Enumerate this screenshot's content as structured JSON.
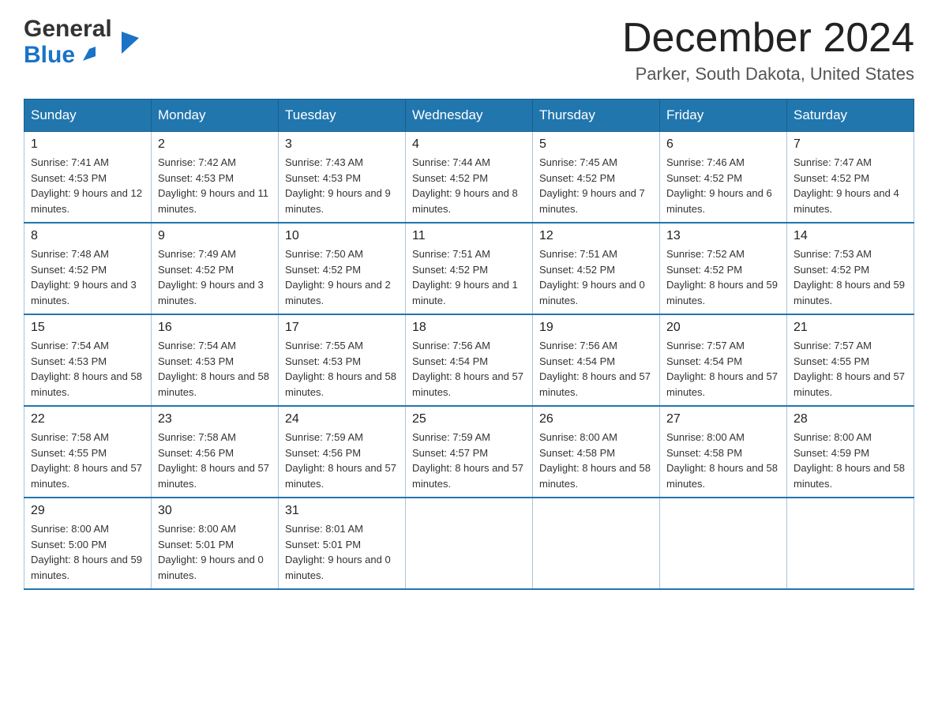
{
  "header": {
    "title": "December 2024",
    "location": "Parker, South Dakota, United States",
    "logo_general": "General",
    "logo_blue": "Blue"
  },
  "days_of_week": [
    "Sunday",
    "Monday",
    "Tuesday",
    "Wednesday",
    "Thursday",
    "Friday",
    "Saturday"
  ],
  "weeks": [
    [
      {
        "day": "1",
        "sunrise": "7:41 AM",
        "sunset": "4:53 PM",
        "daylight": "9 hours and 12 minutes."
      },
      {
        "day": "2",
        "sunrise": "7:42 AM",
        "sunset": "4:53 PM",
        "daylight": "9 hours and 11 minutes."
      },
      {
        "day": "3",
        "sunrise": "7:43 AM",
        "sunset": "4:53 PM",
        "daylight": "9 hours and 9 minutes."
      },
      {
        "day": "4",
        "sunrise": "7:44 AM",
        "sunset": "4:52 PM",
        "daylight": "9 hours and 8 minutes."
      },
      {
        "day": "5",
        "sunrise": "7:45 AM",
        "sunset": "4:52 PM",
        "daylight": "9 hours and 7 minutes."
      },
      {
        "day": "6",
        "sunrise": "7:46 AM",
        "sunset": "4:52 PM",
        "daylight": "9 hours and 6 minutes."
      },
      {
        "day": "7",
        "sunrise": "7:47 AM",
        "sunset": "4:52 PM",
        "daylight": "9 hours and 4 minutes."
      }
    ],
    [
      {
        "day": "8",
        "sunrise": "7:48 AM",
        "sunset": "4:52 PM",
        "daylight": "9 hours and 3 minutes."
      },
      {
        "day": "9",
        "sunrise": "7:49 AM",
        "sunset": "4:52 PM",
        "daylight": "9 hours and 3 minutes."
      },
      {
        "day": "10",
        "sunrise": "7:50 AM",
        "sunset": "4:52 PM",
        "daylight": "9 hours and 2 minutes."
      },
      {
        "day": "11",
        "sunrise": "7:51 AM",
        "sunset": "4:52 PM",
        "daylight": "9 hours and 1 minute."
      },
      {
        "day": "12",
        "sunrise": "7:51 AM",
        "sunset": "4:52 PM",
        "daylight": "9 hours and 0 minutes."
      },
      {
        "day": "13",
        "sunrise": "7:52 AM",
        "sunset": "4:52 PM",
        "daylight": "8 hours and 59 minutes."
      },
      {
        "day": "14",
        "sunrise": "7:53 AM",
        "sunset": "4:52 PM",
        "daylight": "8 hours and 59 minutes."
      }
    ],
    [
      {
        "day": "15",
        "sunrise": "7:54 AM",
        "sunset": "4:53 PM",
        "daylight": "8 hours and 58 minutes."
      },
      {
        "day": "16",
        "sunrise": "7:54 AM",
        "sunset": "4:53 PM",
        "daylight": "8 hours and 58 minutes."
      },
      {
        "day": "17",
        "sunrise": "7:55 AM",
        "sunset": "4:53 PM",
        "daylight": "8 hours and 58 minutes."
      },
      {
        "day": "18",
        "sunrise": "7:56 AM",
        "sunset": "4:54 PM",
        "daylight": "8 hours and 57 minutes."
      },
      {
        "day": "19",
        "sunrise": "7:56 AM",
        "sunset": "4:54 PM",
        "daylight": "8 hours and 57 minutes."
      },
      {
        "day": "20",
        "sunrise": "7:57 AM",
        "sunset": "4:54 PM",
        "daylight": "8 hours and 57 minutes."
      },
      {
        "day": "21",
        "sunrise": "7:57 AM",
        "sunset": "4:55 PM",
        "daylight": "8 hours and 57 minutes."
      }
    ],
    [
      {
        "day": "22",
        "sunrise": "7:58 AM",
        "sunset": "4:55 PM",
        "daylight": "8 hours and 57 minutes."
      },
      {
        "day": "23",
        "sunrise": "7:58 AM",
        "sunset": "4:56 PM",
        "daylight": "8 hours and 57 minutes."
      },
      {
        "day": "24",
        "sunrise": "7:59 AM",
        "sunset": "4:56 PM",
        "daylight": "8 hours and 57 minutes."
      },
      {
        "day": "25",
        "sunrise": "7:59 AM",
        "sunset": "4:57 PM",
        "daylight": "8 hours and 57 minutes."
      },
      {
        "day": "26",
        "sunrise": "8:00 AM",
        "sunset": "4:58 PM",
        "daylight": "8 hours and 58 minutes."
      },
      {
        "day": "27",
        "sunrise": "8:00 AM",
        "sunset": "4:58 PM",
        "daylight": "8 hours and 58 minutes."
      },
      {
        "day": "28",
        "sunrise": "8:00 AM",
        "sunset": "4:59 PM",
        "daylight": "8 hours and 58 minutes."
      }
    ],
    [
      {
        "day": "29",
        "sunrise": "8:00 AM",
        "sunset": "5:00 PM",
        "daylight": "8 hours and 59 minutes."
      },
      {
        "day": "30",
        "sunrise": "8:00 AM",
        "sunset": "5:01 PM",
        "daylight": "9 hours and 0 minutes."
      },
      {
        "day": "31",
        "sunrise": "8:01 AM",
        "sunset": "5:01 PM",
        "daylight": "9 hours and 0 minutes."
      },
      null,
      null,
      null,
      null
    ]
  ],
  "labels": {
    "sunrise": "Sunrise:",
    "sunset": "Sunset:",
    "daylight": "Daylight:"
  },
  "colors": {
    "header_bg": "#2176ae",
    "border": "#aac4d8"
  }
}
